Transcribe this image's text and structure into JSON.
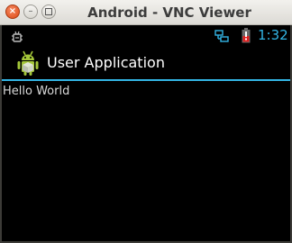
{
  "window": {
    "title": "Android - VNC Viewer",
    "close_glyph": "×",
    "minimize_glyph": "–"
  },
  "status_bar": {
    "time": "1:32",
    "accent_color": "#33b5e5",
    "battery_color": "#e02020",
    "icons": [
      "debug-icon",
      "network-icon",
      "battery-icon"
    ]
  },
  "action_bar": {
    "title": "User Application",
    "icon": "android-app-icon",
    "underline_color": "#33b5e5"
  },
  "content": {
    "text": "Hello World"
  }
}
